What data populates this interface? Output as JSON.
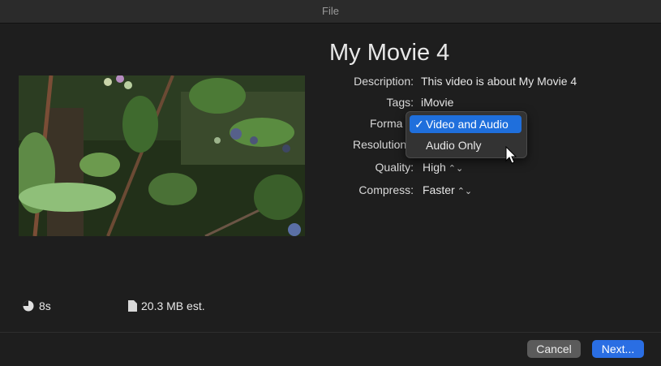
{
  "window": {
    "title": "File"
  },
  "movie": {
    "title": "My Movie 4"
  },
  "fields": {
    "description": {
      "label": "Description:",
      "value": "This video is about My Movie 4"
    },
    "tags": {
      "label": "Tags:",
      "value": "iMovie"
    },
    "format": {
      "label": "Forma",
      "options": [
        "Video and Audio",
        "Audio Only"
      ],
      "selected": "Video and Audio",
      "check": "✓"
    },
    "resolution": {
      "label": "Resolution"
    },
    "quality": {
      "label": "Quality:",
      "value": "High"
    },
    "compress": {
      "label": "Compress:",
      "value": "Faster"
    }
  },
  "info": {
    "duration": "8s",
    "size": "20.3 MB est."
  },
  "buttons": {
    "cancel": "Cancel",
    "next": "Next..."
  },
  "icons": {
    "duration": "clock-icon",
    "size": "document-icon",
    "stepper": "up-down-chevron-icon",
    "cursor": "pointer-cursor-icon"
  },
  "colors": {
    "accent": "#2a6ee3",
    "background": "#1e1e1e",
    "selection": "#1f6fdc"
  }
}
